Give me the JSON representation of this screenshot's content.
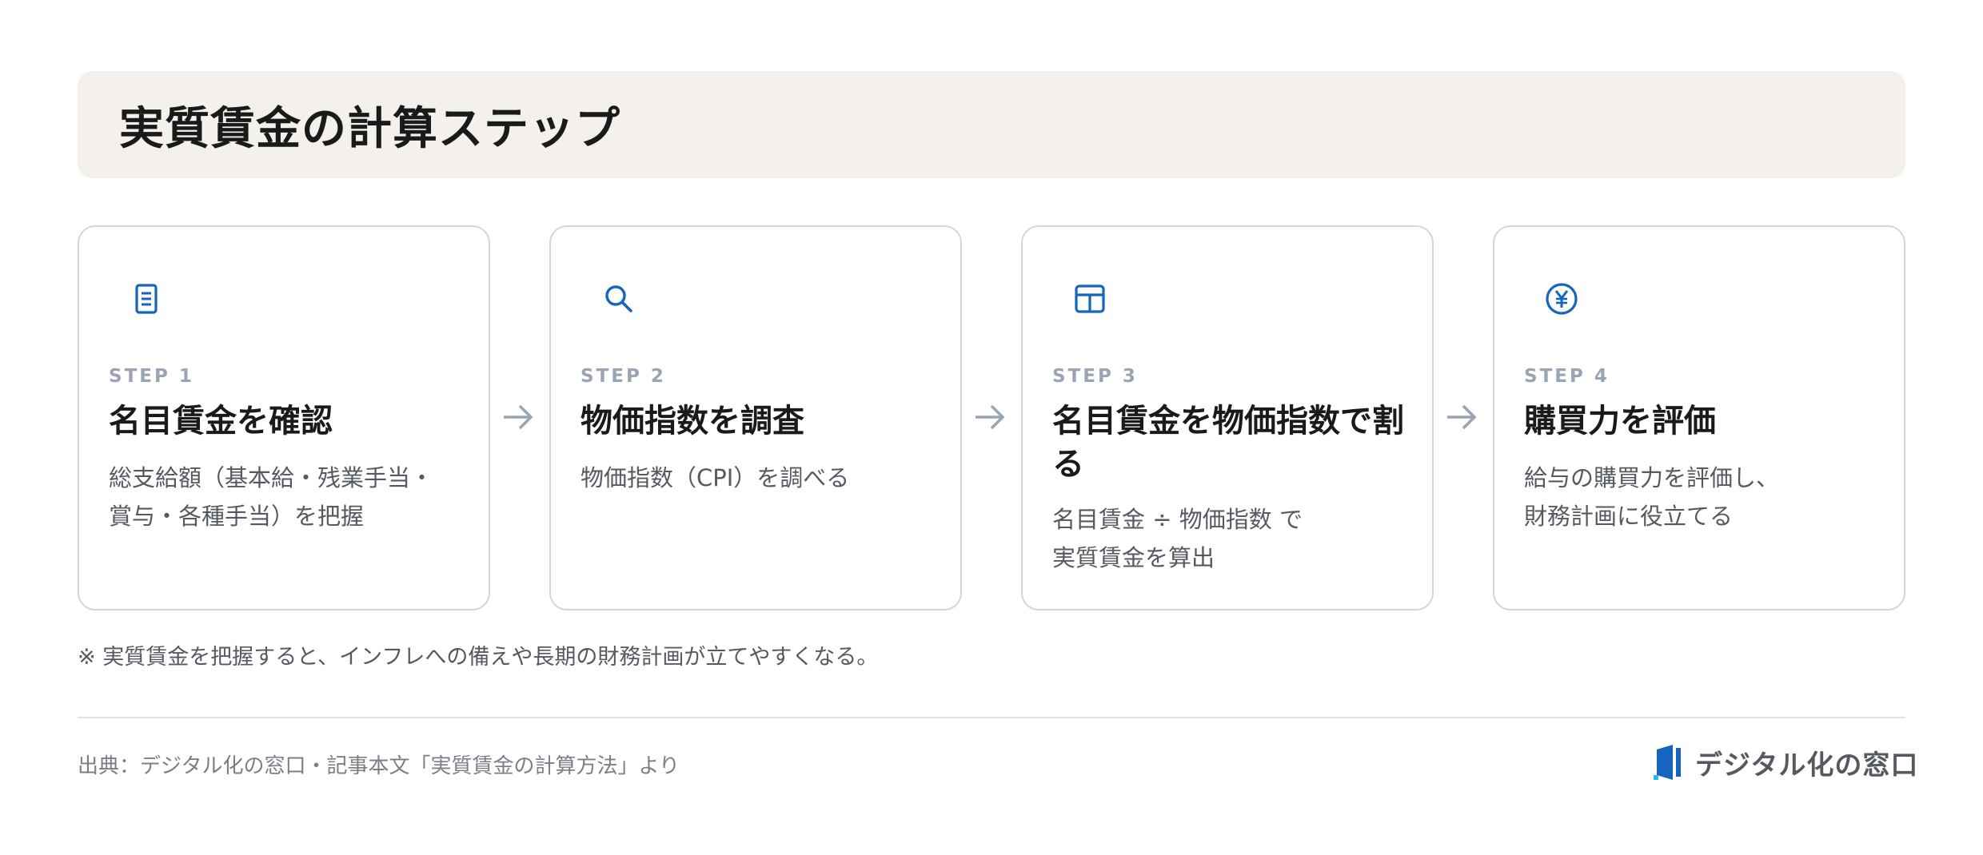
{
  "title": "実質賃金の計算ステップ",
  "steps": [
    {
      "icon": "document-icon",
      "step_label": "STEP 1",
      "heading": "名目賃金を確認",
      "description": "総支給額（基本給・残業手当・\n賞与・各種手当）を把握"
    },
    {
      "icon": "search-icon",
      "step_label": "STEP 2",
      "heading": "物価指数を調査",
      "description": "物価指数（CPI）を調べる"
    },
    {
      "icon": "table-icon",
      "step_label": "STEP 3",
      "heading": "名目賃金を物価指数で割る",
      "description": "名目賃金 ÷ 物価指数 で\n実質賃金を算出"
    },
    {
      "icon": "yen-icon",
      "step_label": "STEP 4",
      "heading": "購買力を評価",
      "description": "給与の購買力を評価し、\n財務計画に役立てる"
    }
  ],
  "note": "※ 実質賃金を把握すると、インフレへの備えや長期の財務計画が立てやすくなる。",
  "source": "出典：デジタル化の窓口・記事本文「実質賃金の計算方法」より",
  "logo_text": "デジタル化の窓口",
  "colors": {
    "accent": "#1565c0",
    "step_label": "#9aa4b2",
    "banner": "#f4f1ec",
    "arrow": "#9aa4b2"
  }
}
